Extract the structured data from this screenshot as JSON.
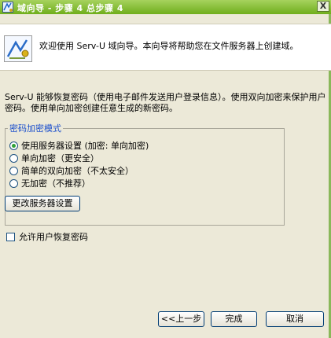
{
  "window": {
    "title": "域向导 - 步骤 4 总步骤 4",
    "close_label": "X"
  },
  "header": {
    "text": "欢迎使用 Serv-U 域向导。本向导将帮助您在文件服务器上创建域。"
  },
  "description": "Serv-U 能够恢复密码（使用电子邮件发送用户登录信息）。使用双向加密来保护用户密码。使用单向加密创建任意生成的新密码。",
  "password_mode": {
    "legend": "密码加密模式",
    "options": [
      {
        "label": "使用服务器设置 (加密: 单向加密)",
        "checked": true
      },
      {
        "label": "单向加密（更安全）",
        "checked": false
      },
      {
        "label": "简单的双向加密（不太安全）",
        "checked": false
      },
      {
        "label": "无加密（不推荐）",
        "checked": false
      }
    ],
    "change_button": "更改服务器设置"
  },
  "allow_recovery": {
    "label": "允许用户恢复密码",
    "checked": false
  },
  "footer": {
    "back": "<<上一步",
    "finish": "完成",
    "cancel": "取消"
  }
}
